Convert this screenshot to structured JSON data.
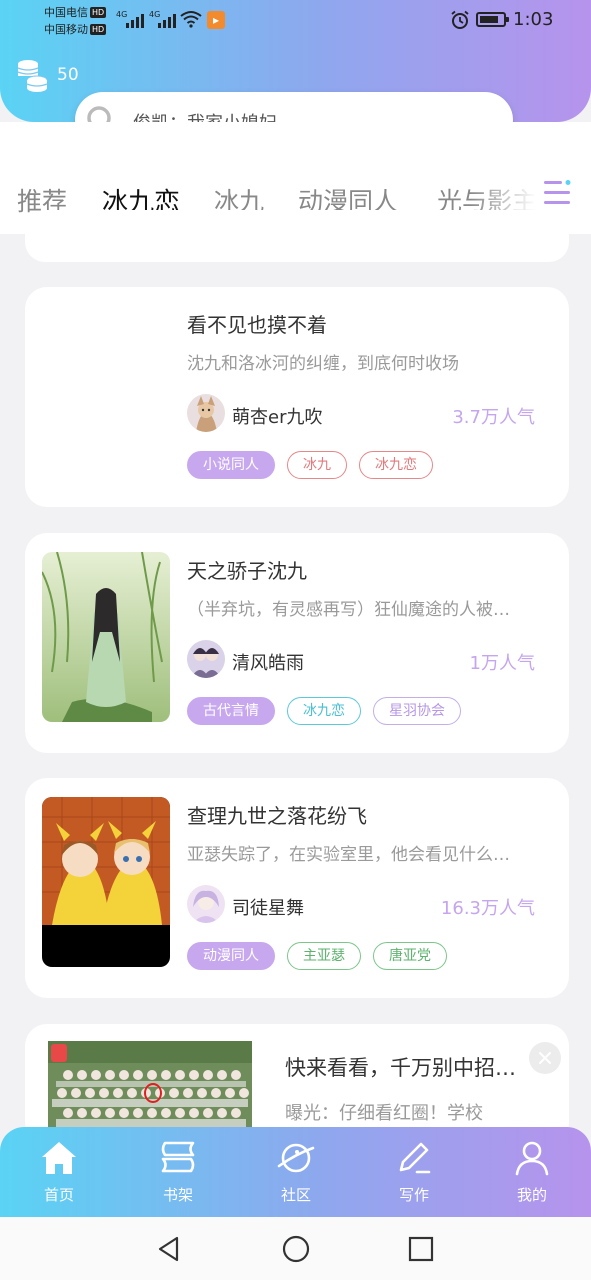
{
  "status_bar": {
    "carrier1": "中国电信",
    "carrier2": "中国移动",
    "hd": "HD",
    "net1": "4G",
    "net2": "4G",
    "time": "1:03"
  },
  "header": {
    "coins": "50",
    "search_text": "俊凯：我家小媳妇"
  },
  "tabs": [
    {
      "label": "推荐"
    },
    {
      "label": "冰九恋"
    },
    {
      "label": "冰九"
    },
    {
      "label": "动漫同人"
    },
    {
      "label": "光与影主题"
    }
  ],
  "cards": [
    {
      "title": "看不见也摸不着",
      "desc": "沈九和洛冰河的纠缠，到底何时收场",
      "author": "萌杏er九吹",
      "popularity": "3.7万人气",
      "tags": [
        "小说同人",
        "冰九",
        "冰九恋"
      ]
    },
    {
      "title": "天之骄子沈九",
      "desc": "（半弃坑，有灵感再写）狂仙魔途的人被…",
      "author": "清风皓雨",
      "popularity": "1万人气",
      "tags": [
        "古代言情",
        "冰九恋",
        "星羽协会"
      ]
    },
    {
      "title": "查理九世之落花纷飞",
      "desc": "亚瑟失踪了，在实验室里，他会看见什么…",
      "author": "司徒星舞",
      "popularity": "16.3万人气",
      "tags": [
        "动漫同人",
        "主亚瑟",
        "唐亚党"
      ]
    }
  ],
  "ad": {
    "title": "快来看看，千万别中招…",
    "desc": "曝光：仔细看红圈！学校"
  },
  "bottom_nav": [
    {
      "label": "首页",
      "icon": "home-icon"
    },
    {
      "label": "书架",
      "icon": "bookshelf-icon"
    },
    {
      "label": "社区",
      "icon": "planet-icon"
    },
    {
      "label": "写作",
      "icon": "pen-icon"
    },
    {
      "label": "我的",
      "icon": "profile-icon"
    }
  ],
  "colors": {
    "gradient_start": "#5ad3f4",
    "gradient_end": "#b693ec",
    "accent": "#b48cf0",
    "popularity": "#c5a6ee"
  }
}
